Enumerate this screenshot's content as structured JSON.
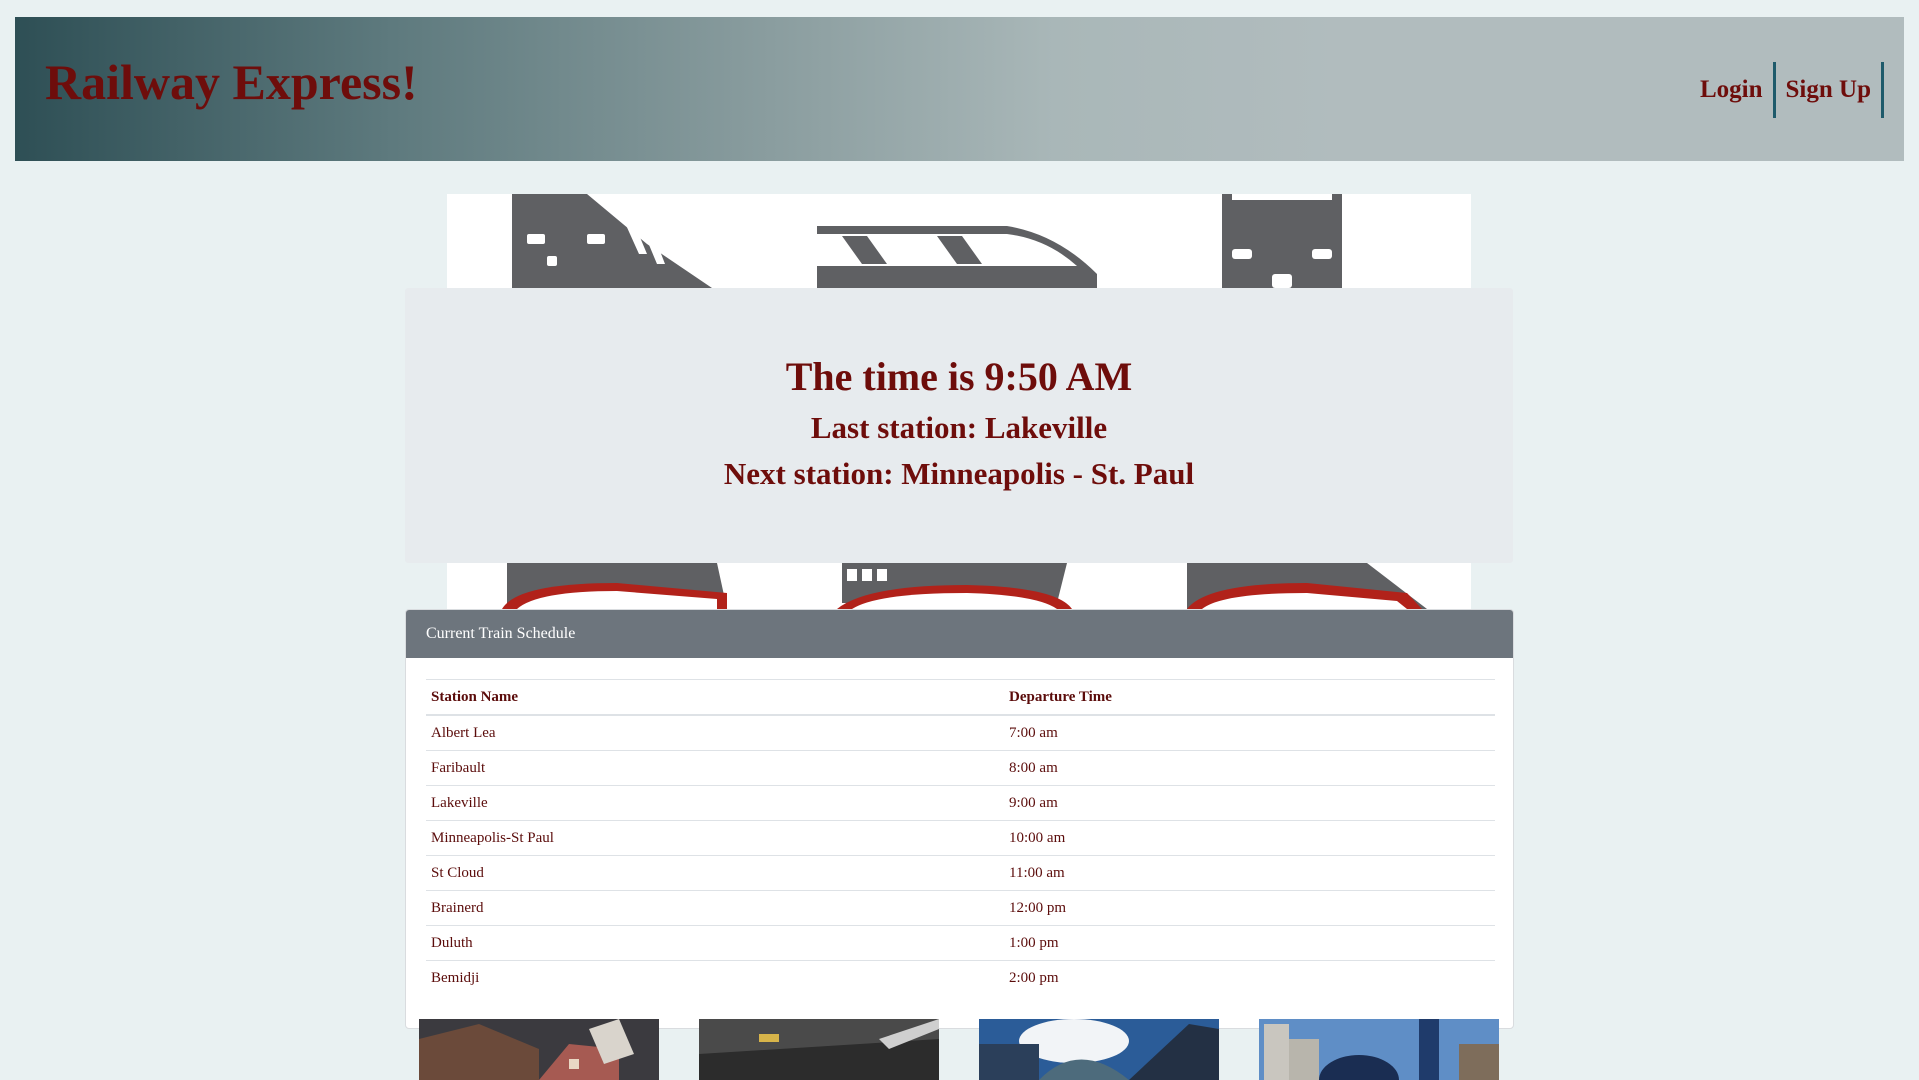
{
  "header": {
    "brand": "Railway Express!",
    "nav": [
      {
        "label": "Login"
      },
      {
        "label": "Sign Up"
      }
    ]
  },
  "status": {
    "time_line": "The time is 9:50 AM",
    "last_station_line": "Last station: Lakeville",
    "next_station_line": "Next station: Minneapolis - St. Paul"
  },
  "schedule": {
    "title": "Current Train Schedule",
    "columns": [
      "Station Name",
      "Departure Time"
    ],
    "rows": [
      {
        "station": "Albert Lea",
        "time": "7:00 am"
      },
      {
        "station": "Faribault",
        "time": "8:00 am"
      },
      {
        "station": "Lakeville",
        "time": "9:00 am"
      },
      {
        "station": "Minneapolis-St Paul",
        "time": "10:00 am"
      },
      {
        "station": "St Cloud",
        "time": "11:00 am"
      },
      {
        "station": "Brainerd",
        "time": "12:00 pm"
      },
      {
        "station": "Duluth",
        "time": "1:00 pm"
      },
      {
        "station": "Bemidji",
        "time": "2:00 pm"
      }
    ]
  },
  "colors": {
    "text_accent": "#6e0d0b",
    "card_header": "#6d757d",
    "nav_divider": "#1e5a6b",
    "page_background": "#e9f1f2"
  }
}
